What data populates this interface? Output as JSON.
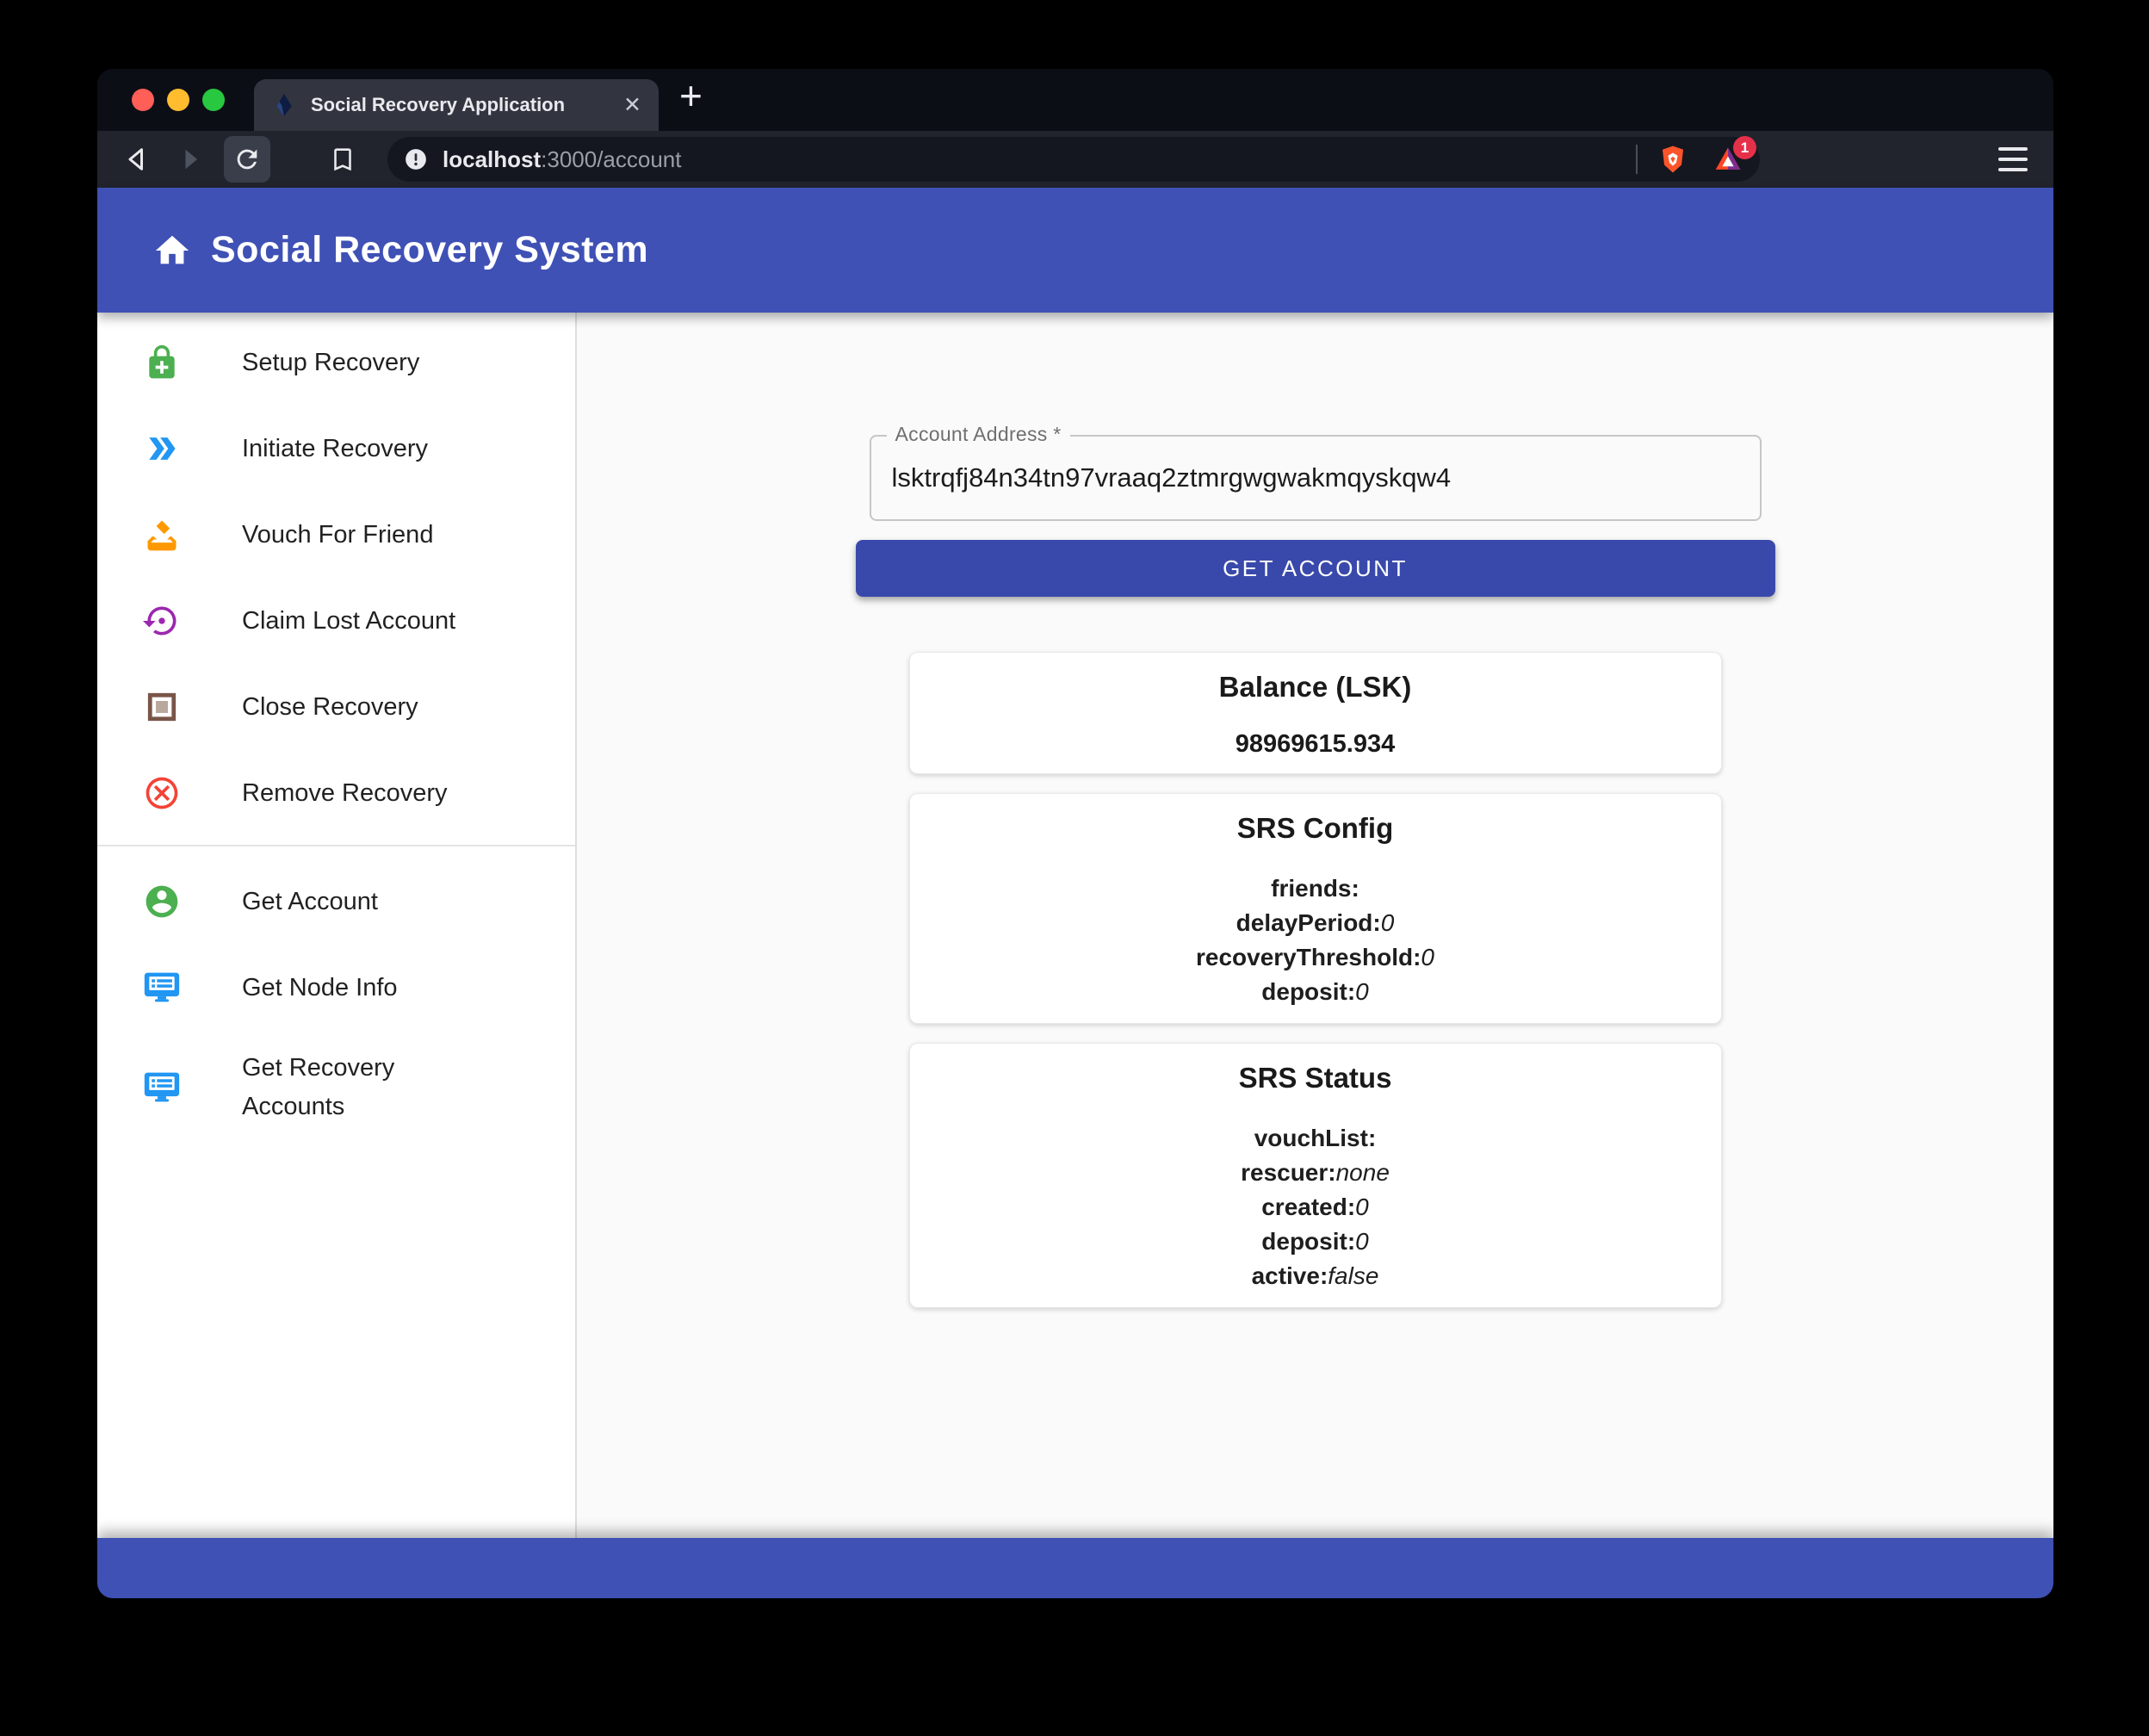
{
  "browser": {
    "tab_title": "Social Recovery Application",
    "tab_close_icon": "✕",
    "new_tab_icon": "+",
    "url_host": "localhost",
    "url_rest": ":3000/account",
    "rewards_badge": "1"
  },
  "header": {
    "title": "Social Recovery System"
  },
  "sidebar": {
    "items": [
      {
        "label": "Setup Recovery",
        "icon": "lock-plus-icon"
      },
      {
        "label": "Initiate Recovery",
        "icon": "double-arrow-icon"
      },
      {
        "label": "Vouch For Friend",
        "icon": "ballot-icon"
      },
      {
        "label": "Claim Lost Account",
        "icon": "restore-icon"
      },
      {
        "label": "Close Recovery",
        "icon": "stop-square-icon"
      },
      {
        "label": "Remove Recovery",
        "icon": "cancel-icon"
      }
    ],
    "secondary_items": [
      {
        "label": "Get Account",
        "icon": "account-circle-icon"
      },
      {
        "label": "Get Node Info",
        "icon": "monitor-list-icon"
      },
      {
        "label": "Get Recovery Accounts",
        "icon": "monitor-list-icon"
      }
    ]
  },
  "main": {
    "address_field": {
      "label": "Account Address *",
      "value": "lsktrqfj84n34tn97vraaq2ztmrgwgwakmqyskqw4"
    },
    "get_account_button": "GET ACCOUNT",
    "cards": {
      "balance": {
        "title": "Balance (LSK)",
        "value": "98969615.934"
      },
      "srs_config": {
        "title": "SRS Config",
        "fields": [
          {
            "label": "friends:",
            "value": ""
          },
          {
            "label": "delayPeriod:",
            "value": "0"
          },
          {
            "label": "recoveryThreshold:",
            "value": "0"
          },
          {
            "label": "deposit:",
            "value": "0"
          }
        ]
      },
      "srs_status": {
        "title": "SRS Status",
        "fields": [
          {
            "label": "vouchList:",
            "value": ""
          },
          {
            "label": "rescuer:",
            "value": "none"
          },
          {
            "label": "created:",
            "value": "0"
          },
          {
            "label": "deposit:",
            "value": "0"
          },
          {
            "label": "active:",
            "value": "false"
          }
        ]
      }
    }
  },
  "colors": {
    "header_blue": "#3f51b5",
    "button_blue": "#3949ab",
    "footer_blue": "#3f51b5",
    "green": "#4caf50",
    "blue": "#2196f3",
    "orange": "#ff9800",
    "purple": "#9c27b0",
    "brown": "#795548",
    "red": "#f44336",
    "badge_red": "#e5304a"
  }
}
